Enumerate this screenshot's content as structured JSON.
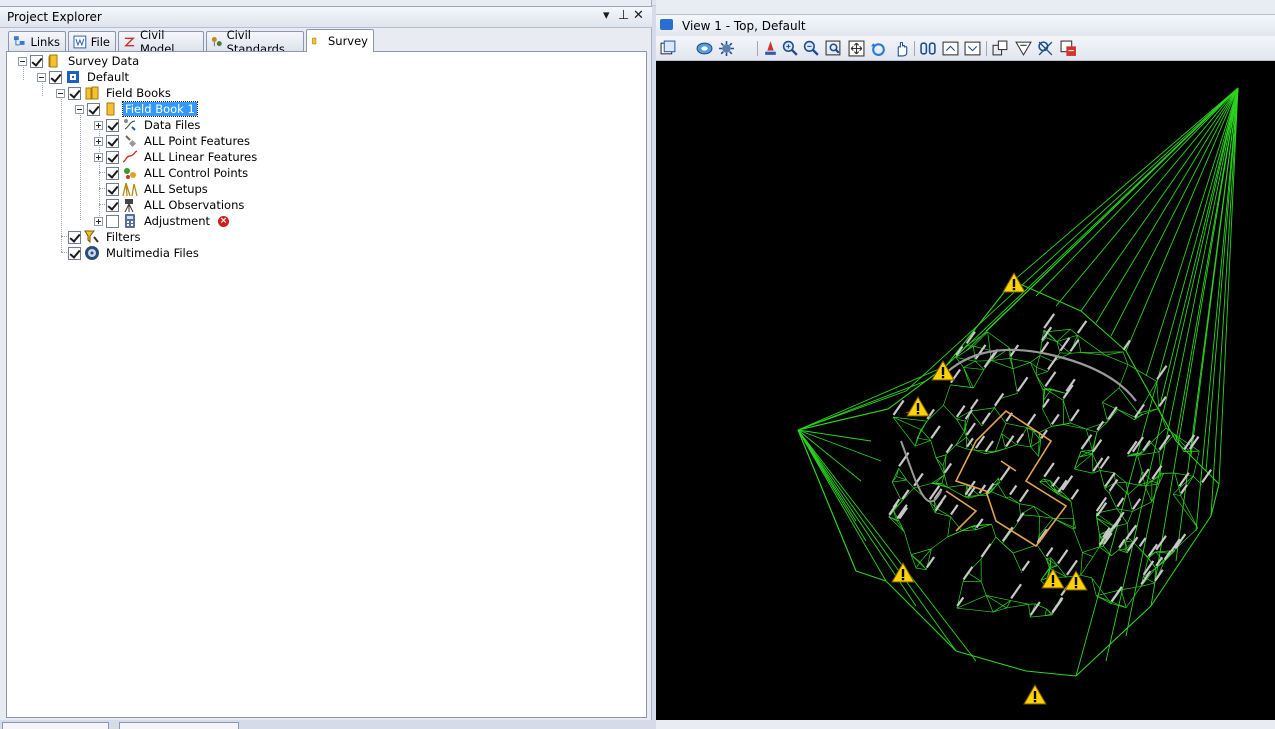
{
  "explorer": {
    "title": "Project Explorer",
    "controls": {
      "dropdown": "▾",
      "pin": "⊥",
      "close": "✕"
    },
    "tabs": [
      {
        "label": "Links",
        "icon": "links-icon"
      },
      {
        "label": "File",
        "icon": "file-icon"
      },
      {
        "label": "Civil Model",
        "icon": "civil-model-icon"
      },
      {
        "label": "Civil Standards",
        "icon": "civil-standards-icon"
      },
      {
        "label": "Survey",
        "icon": "survey-icon",
        "active": true
      }
    ],
    "tree": [
      {
        "label": "Survey Data",
        "icon": "folder-icon",
        "checked": true,
        "expanded": true
      },
      {
        "label": "Default",
        "icon": "project-icon",
        "checked": true,
        "expanded": true
      },
      {
        "label": "Field Books",
        "icon": "field-books-icon",
        "checked": true,
        "expanded": true
      },
      {
        "label": "Field Book 1",
        "icon": "field-book-icon",
        "checked": true,
        "expanded": true,
        "selected": true
      },
      {
        "label": "Data Files",
        "icon": "data-files-icon",
        "checked": true,
        "expandable": true
      },
      {
        "label": "ALL Point Features",
        "icon": "point-features-icon",
        "checked": true,
        "expandable": true
      },
      {
        "label": "ALL Linear Features",
        "icon": "linear-features-icon",
        "checked": true,
        "expandable": true
      },
      {
        "label": "ALL Control Points",
        "icon": "control-points-icon",
        "checked": true
      },
      {
        "label": "ALL Setups",
        "icon": "setups-icon",
        "checked": true
      },
      {
        "label": "ALL Observations",
        "icon": "observations-icon",
        "checked": true
      },
      {
        "label": "Adjustment",
        "icon": "adjustment-icon",
        "checked": false,
        "expandable": true,
        "error": "×"
      },
      {
        "label": "Filters",
        "icon": "filter-icon",
        "checked": true
      },
      {
        "label": "Multimedia Files",
        "icon": "multimedia-icon",
        "checked": true
      }
    ]
  },
  "view": {
    "title": "View 1 - Top, Default",
    "toolbar": [
      "view-attributes-icon",
      "display-style-icon",
      "view-display-icon",
      "update-view-icon",
      "zoom-in-icon",
      "zoom-out-icon",
      "window-area-icon",
      "fit-view-icon",
      "rotate-view-icon",
      "pan-view-icon",
      "view-previous-icon",
      "view-next-icon",
      "copy-view-icon",
      "clip-volume-icon",
      "clip-mask-icon",
      "view-groups-icon"
    ],
    "background": "#000000",
    "mesh_color": "#2bd41f",
    "warning_color": "#ffd200"
  },
  "colors": {
    "selection": "#3399ff",
    "error": "#d21d1d"
  }
}
